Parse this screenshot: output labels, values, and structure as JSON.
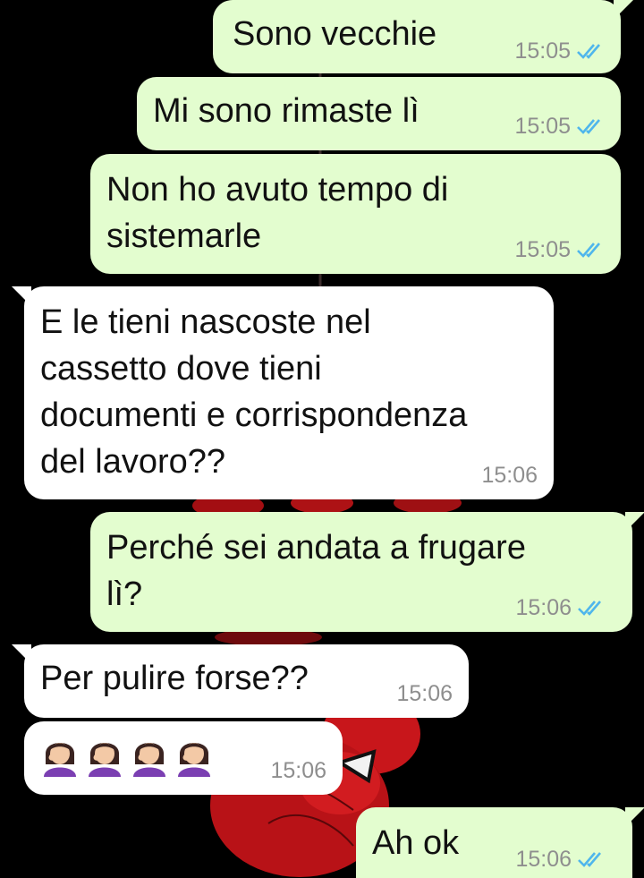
{
  "messages": [
    {
      "direction": "outgoing",
      "text": "Sono vecchie",
      "time": "15:05",
      "status": "read"
    },
    {
      "direction": "outgoing",
      "text": "Mi sono rimaste lì",
      "time": "15:05",
      "status": "read"
    },
    {
      "direction": "outgoing",
      "text": "Non ho avuto tempo di\nsistemarle",
      "time": "15:05",
      "status": "read"
    },
    {
      "direction": "incoming",
      "text": "E le tieni nascoste nel\ncassetto dove tieni\ndocumenti e corrispondenza\ndel lavoro??",
      "time": "15:06"
    },
    {
      "direction": "outgoing",
      "text": "Perché sei andata a frugare\nlì?",
      "time": "15:06",
      "status": "read"
    },
    {
      "direction": "incoming",
      "text": "Per pulire forse??",
      "time": "15:06"
    },
    {
      "direction": "incoming",
      "emoji": [
        "woman-facepalming",
        "woman-facepalming",
        "woman-facepalming",
        "woman-facepalming"
      ],
      "time": "15:06"
    },
    {
      "direction": "outgoing",
      "text": "Ah ok",
      "time": "15:06",
      "status": "read"
    }
  ],
  "colors": {
    "outgoing_bubble": "#e3fdcf",
    "incoming_bubble": "#ffffff",
    "read_ticks": "#4fb6ec",
    "timestamp": "#8e8e8e",
    "wallpaper": "#000000"
  },
  "wallpaper": {
    "subject": "spider-man-mask"
  }
}
